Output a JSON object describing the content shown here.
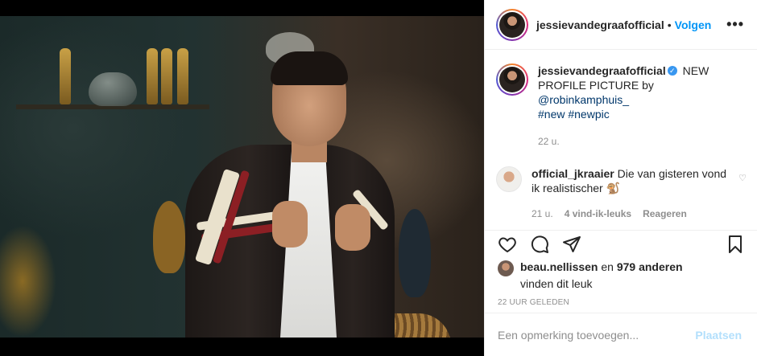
{
  "header": {
    "username": "jessievandegraafofficial",
    "separator": "•",
    "follow_label": "Volgen",
    "more_label": "•••"
  },
  "caption": {
    "username": "jessievandegraafofficial",
    "verified_mark": "✓",
    "text": "NEW PROFILE PICTURE by ",
    "mention": "@robinkamphuis_",
    "hashtags": "#new #newpic",
    "time": "22 u."
  },
  "comment": {
    "username": "official_jkraaier",
    "text": "Die van gisteren vond ik realistischer 🐒",
    "time": "21 u.",
    "likes": "4 vind-ik-leuks",
    "reply_label": "Reageren",
    "heart": "♡"
  },
  "likes": {
    "user": "beau.nellissen",
    "middle": " en ",
    "count": "979 anderen",
    "line2": "vinden dit leuk"
  },
  "post_time": "22 uur geleden",
  "add_comment": {
    "placeholder": "Een opmerking toevoegen...",
    "post_label": "Plaatsen"
  },
  "icons": {
    "like": "heart-icon",
    "comment": "comment-icon",
    "share": "paper-plane-icon",
    "save": "bookmark-icon"
  },
  "colors": {
    "accent": "#0095f6",
    "post_disabled": "#b2dffc",
    "verified": "#3897f0",
    "secondary_text": "#8e8e8e"
  }
}
